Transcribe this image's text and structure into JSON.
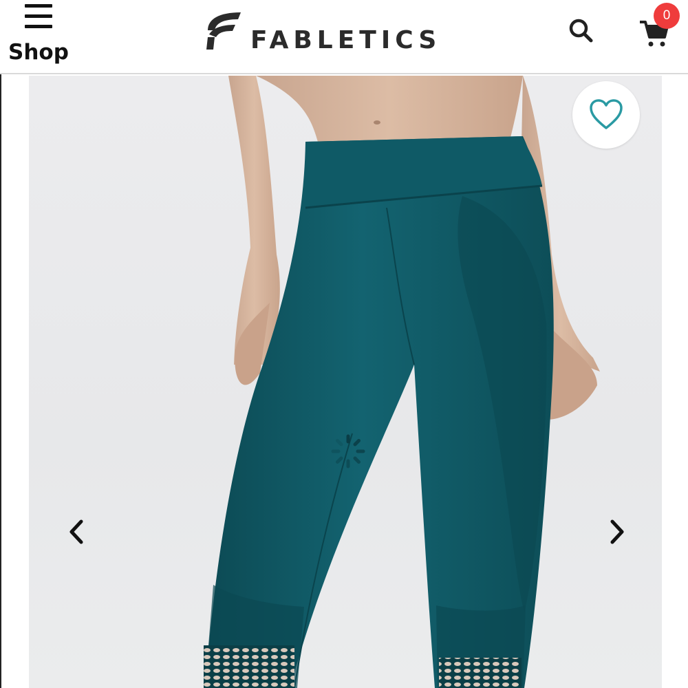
{
  "header": {
    "menu_label": "Shop",
    "brand_name": "FABLETICS",
    "cart_count": "0"
  },
  "icons": {
    "menu": "hamburger-icon",
    "search": "search-icon",
    "cart": "cart-icon",
    "favorite": "heart-icon",
    "previous": "chevron-left-icon",
    "next": "chevron-right-icon",
    "loading": "spinner-icon"
  },
  "colors": {
    "accent_teal": "#2a9aa3",
    "badge_red": "#ef3c3c",
    "product_color": "#0f5560"
  }
}
